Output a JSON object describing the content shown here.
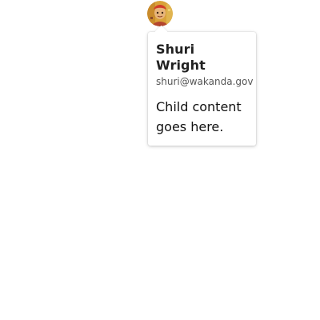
{
  "avatar": {
    "icon": "user-photo-avatar",
    "colors": {
      "background": "#d9a23a",
      "accent": "#b5462e",
      "face": "#e7b57c",
      "hat": "#d23c2a"
    }
  },
  "popover": {
    "user": {
      "name": "Shuri Wright",
      "email": "shuri@wakanda.gov"
    },
    "body": "Child content goes here."
  }
}
